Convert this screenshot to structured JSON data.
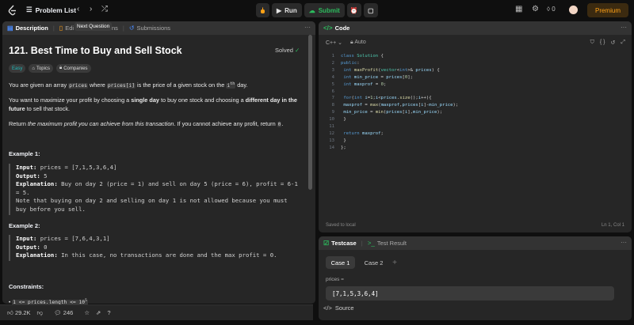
{
  "topbar": {
    "problem_list": "Problem List",
    "run": "Run",
    "submit": "Submit",
    "streak": "0",
    "premium": "Premium"
  },
  "left_tabs": {
    "description": "Description",
    "editorial": "Edi",
    "solutions": "tions",
    "submissions": "Submissions",
    "tooltip": "Next Question"
  },
  "problem": {
    "title": "121. Best Time to Buy and Sell Stock",
    "status": "Solved",
    "chips": [
      "Easy",
      "Topics",
      "Companies"
    ],
    "p1_a": "You are given an array ",
    "p1_code1": "prices",
    "p1_b": " where ",
    "p1_code2": "prices[i]",
    "p1_c": " is the price of a given stock on the ",
    "p1_code3": "i",
    "p1_sup": "th",
    "p1_d": " day.",
    "p2_a": "You want to maximize your profit by choosing a ",
    "p2_b1": "single day",
    "p2_c": " to buy one stock and choosing a ",
    "p2_b2": "different day in the future",
    "p2_d": " to sell that stock.",
    "p3_a": "Return ",
    "p3_i": "the maximum profit you can achieve from this transaction",
    "p3_b": ". If you cannot achieve any profit, return ",
    "p3_code": "0",
    "p3_c": ".",
    "ex1_title": "Example 1:",
    "ex1_input_label": "Input:",
    "ex1_input": " prices = [7,1,5,3,6,4]",
    "ex1_output_label": "Output:",
    "ex1_output": " 5",
    "ex1_expl_label": "Explanation:",
    "ex1_expl_1": " Buy on day 2 (price = 1) and sell on day 5 (price = 6), profit = 6-1",
    "ex1_expl_2": "= 5.",
    "ex1_note_1": "Note that buying on day 2 and selling on day 1 is not allowed because you must",
    "ex1_note_2": "buy before you sell.",
    "ex2_title": "Example 2:",
    "ex2_input_label": "Input:",
    "ex2_input": " prices = [7,6,4,3,1]",
    "ex2_output_label": "Output:",
    "ex2_output": " 0",
    "ex2_expl_label": "Explanation:",
    "ex2_expl": " In this case, no transactions are done and the max profit = 0.",
    "constraints_title": "Constraints:",
    "constraint_1": "1 <= prices.length <= 10"
  },
  "stats": {
    "likes": "29.2K",
    "comments": "246"
  },
  "code": {
    "title": "Code",
    "language": "C++",
    "auto": "Auto",
    "saved": "Saved to local",
    "position": "Ln 1, Col 1",
    "lines": [
      "class Solution {",
      "public:",
      "    int maxProfit(vector<int>& prices) {",
      "        int min_price = prices[0];",
      "        int maxprof = 0;",
      "",
      "        for(int i=1;i<prices.size();i++){",
      "            maxprof = max(maxprof,prices[i]-min_price);",
      "            min_price = min(prices[i],min_price);",
      "        }",
      "",
      "        return maxprof;",
      "    }",
      "};"
    ]
  },
  "testcase": {
    "tab1": "Testcase",
    "tab2": "Test Result",
    "case1": "Case 1",
    "case2": "Case 2",
    "add": "+",
    "var_label": "prices =",
    "var_value": "[7,1,5,3,6,4]",
    "source": "Source"
  }
}
